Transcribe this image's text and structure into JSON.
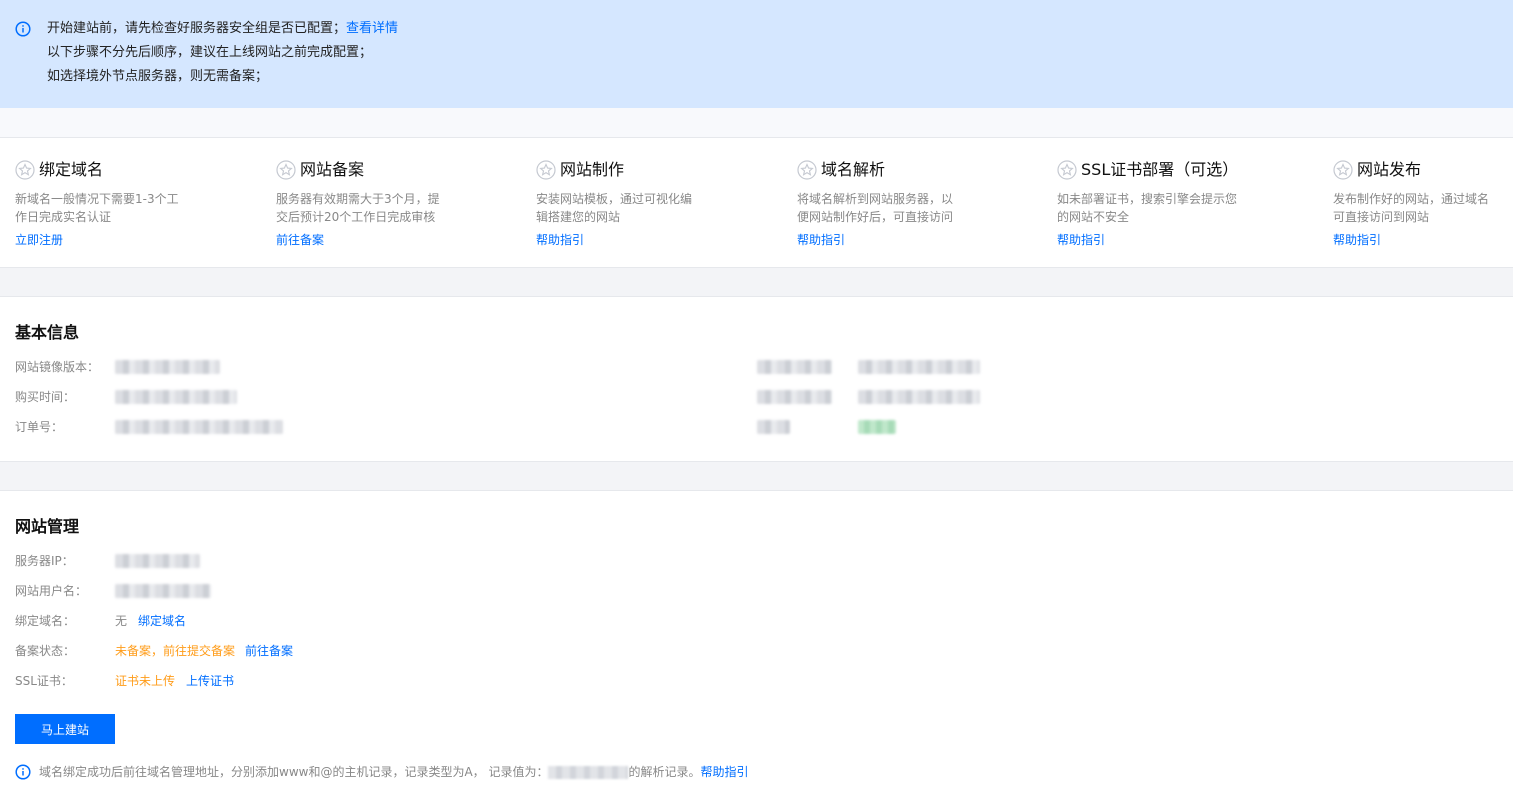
{
  "notice": {
    "line1": "开始建站前，请先检查好服务器安全组是否已配置；",
    "line1_link": "查看详情",
    "line2": "以下步骤不分先后顺序，建议在上线网站之前完成配置；",
    "line3": "如选择境外节点服务器，则无需备案；"
  },
  "steps": [
    {
      "title": "绑定域名",
      "desc1": "新域名一般情况下需要1-3个工",
      "desc2": "作日完成实名认证",
      "action": "立即注册"
    },
    {
      "title": "网站备案",
      "desc1": "服务器有效期需大于3个月，提",
      "desc2": "交后预计20个工作日完成审核",
      "action": "前往备案"
    },
    {
      "title": "网站制作",
      "desc1": "安装网站模板，通过可视化编",
      "desc2": "辑搭建您的网站",
      "action": "帮助指引"
    },
    {
      "title": "域名解析",
      "desc1": "将域名解析到网站服务器，以",
      "desc2": "便网站制作好后，可直接访问",
      "action": "帮助指引"
    },
    {
      "title": "SSL证书部署（可选）",
      "desc1": "如未部署证书，搜索引擎会提示您",
      "desc2": "的网站不安全",
      "action": "帮助指引"
    },
    {
      "title": "网站发布",
      "desc1": "发布制作好的网站，通过域名",
      "desc2": "可直接访问到网站",
      "action": "帮助指引"
    }
  ],
  "basic": {
    "title": "基本信息",
    "image_version_label": "网站镜像版本：",
    "purchase_time_label": "购买时间：",
    "order_no_label": "订单号："
  },
  "mgmt": {
    "title": "网站管理",
    "server_ip_label": "服务器IP：",
    "username_label": "网站用户名：",
    "domain_label": "绑定域名：",
    "domain_value": "无",
    "domain_link": "绑定域名",
    "record_label": "备案状态：",
    "record_value": "未备案，前往提交备案",
    "record_link": "前往备案",
    "ssl_label": "SSL证书：",
    "ssl_value": "证书未上传",
    "ssl_link": "上传证书",
    "build_button": "马上建站",
    "tip_text": "域名绑定成功后前往域名管理地址，分别添加www和@的主机记录，记录类型为A， 记录值为：",
    "tip_after": "的解析记录。",
    "tip_link": "帮助指引"
  },
  "colors": {
    "accent": "#006eff",
    "warning": "#ff9c19",
    "notice_bg": "#d5e7ff"
  }
}
